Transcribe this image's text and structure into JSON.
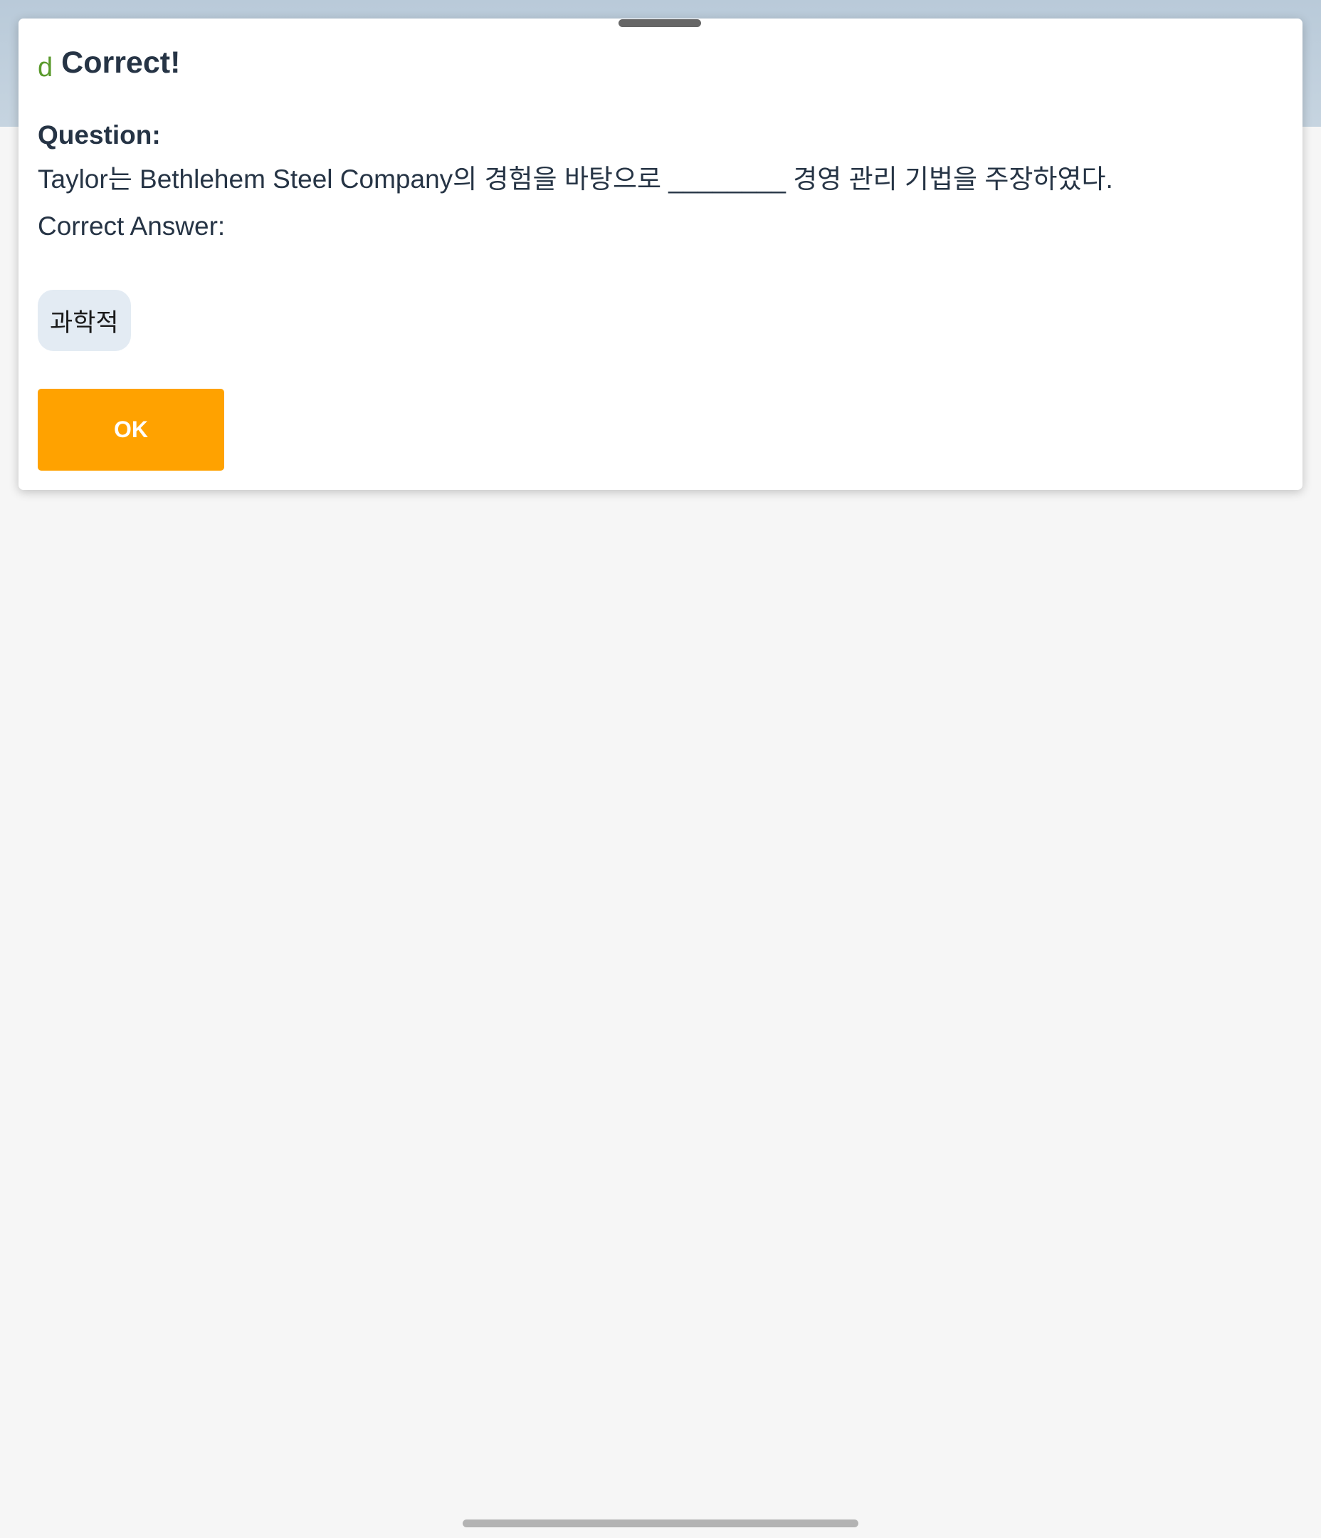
{
  "dialog": {
    "status_icon": "d",
    "title": "Correct!",
    "question_label": "Question:",
    "question_text": "Taylor는 Bethlehem Steel Company의 경험을 바탕으로 ________ 경영 관리 기법을 주장하였다.",
    "answer_label": "Correct Answer:",
    "answer_value": "과학적",
    "ok_label": "OK"
  },
  "colors": {
    "accent": "#ffa200",
    "success": "#5a9a2c",
    "text": "#263445",
    "chip_background": "#e3ebf3",
    "background": "#f6f6f6",
    "top_band": "#c6d4e0"
  }
}
